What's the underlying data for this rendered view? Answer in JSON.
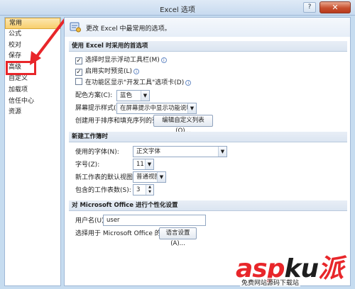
{
  "window": {
    "title": "Excel 选项",
    "help_label": "?",
    "close_label": "✕"
  },
  "sidebar": {
    "items": [
      {
        "label": "常用"
      },
      {
        "label": "公式"
      },
      {
        "label": "校对"
      },
      {
        "label": "保存"
      },
      {
        "label": "高级"
      },
      {
        "label": "自定义"
      },
      {
        "label": "加载项"
      },
      {
        "label": "信任中心"
      },
      {
        "label": "资源"
      }
    ],
    "selected_index": 0
  },
  "banner": {
    "text": "更改 Excel 中最常用的选项。"
  },
  "section_top": {
    "title": "使用 Excel 时采用的首选项",
    "show_minitoolbar": {
      "label": "选择时显示浮动工具栏(M)",
      "checked": true
    },
    "live_preview": {
      "label": "启用实时预览(L)",
      "checked": true
    },
    "developer_tab": {
      "label": "在功能区显示\"开发工具\"选项卡(D)",
      "checked": false
    },
    "color_scheme": {
      "label": "配色方案(C):",
      "value": "蓝色"
    },
    "screentip_style": {
      "label": "屏幕提示样式(R):",
      "value": "在屏幕提示中显示功能说明"
    },
    "custom_lists": {
      "label": "创建用于排序和填充序列的列表:",
      "button": "编辑自定义列表(O)..."
    }
  },
  "section_new": {
    "title": "新建工作簿时",
    "font": {
      "label": "使用的字体(N):",
      "value": "正文字体"
    },
    "font_size": {
      "label": "字号(Z):",
      "value": "11"
    },
    "default_view": {
      "label": "新工作表的默认视图(V):",
      "value": "普通视图"
    },
    "sheet_count": {
      "label": "包含的工作表数(S):",
      "value": "3"
    }
  },
  "section_personal": {
    "title": "对 Microsoft Office 进行个性化设置",
    "username": {
      "label": "用户名(U):",
      "value": "user"
    },
    "language": {
      "label": "选择用于 Microsoft Office 的语言:",
      "button": "语言设置(A)..."
    }
  },
  "watermark": {
    "brand_a": "asp",
    "brand_b": "ku",
    "brand_c": "派",
    "sub": "免费网站源码下载站"
  },
  "colors": {
    "annotation_red": "#e8262a",
    "selected_bg": "#f8cf6e"
  }
}
